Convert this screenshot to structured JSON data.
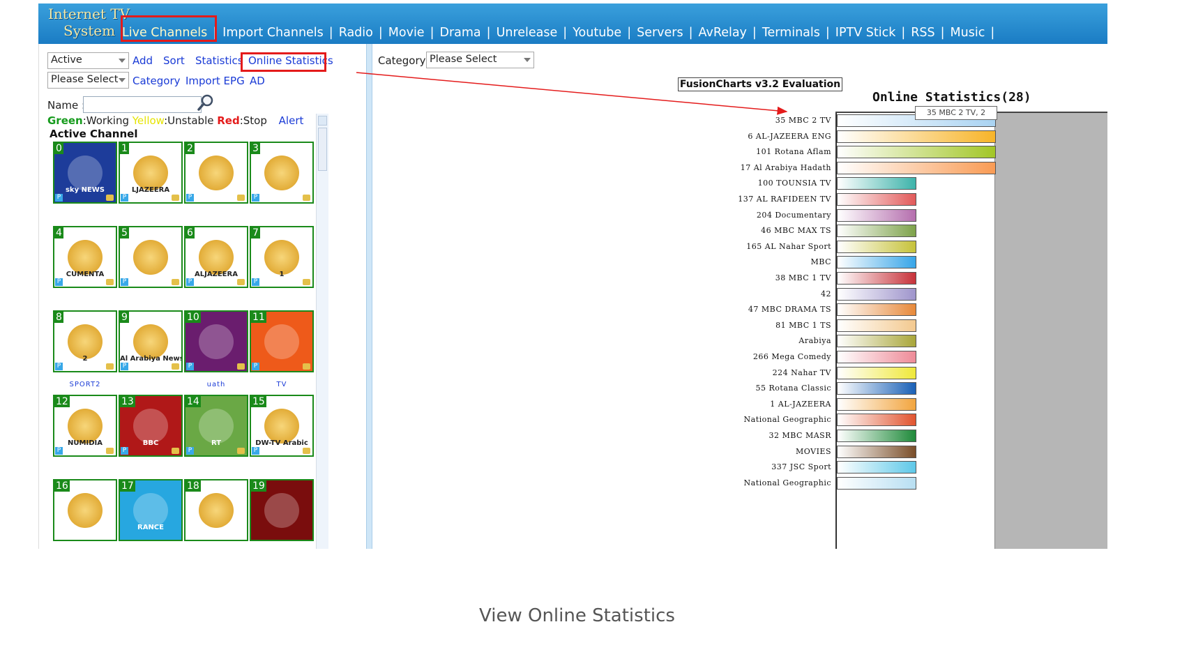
{
  "header": {
    "logo_line1": "Internet TV",
    "logo_line2": "System",
    "nav": [
      "Live Channels",
      "Import Channels",
      "Radio",
      "Movie",
      "Drama",
      "Unrelease",
      "Youtube",
      "Servers",
      "AvRelay",
      "Terminals",
      "IPTV Stick",
      "RSS",
      "Music"
    ],
    "active_nav": "Live Channels"
  },
  "left": {
    "status_select": "Active",
    "category_select": "Please Select",
    "links_row1": [
      "Add",
      "Sort",
      "Statistics",
      "Online Statistics"
    ],
    "links_row2": [
      "Category",
      "Import EPG",
      "AD"
    ],
    "name_label": "Name :",
    "legend": {
      "green": "Green",
      "green_text": ":Working ",
      "yellow": "Yellow",
      "yellow_text": ":Unstable ",
      "red": "Red",
      "red_text": ":Stop",
      "alert": "Alert"
    },
    "section_title": "Active Channel",
    "channels": [
      {
        "num": "0",
        "logo": "sky-news-arabia-logo",
        "bg": "#1d3c9a",
        "text": "sky NEWS"
      },
      {
        "num": "1",
        "logo": "aljazeera-logo",
        "bg": "#ffffff",
        "text": "LJAZEERA"
      },
      {
        "num": "2",
        "logo": "aljazeera-logo",
        "bg": "#ffffff",
        "text": ""
      },
      {
        "num": "3",
        "logo": "aljazeera-logo",
        "bg": "#ffffff",
        "text": ""
      },
      {
        "num": "4",
        "logo": "aljazeera-documentary-logo",
        "bg": "#ffffff",
        "text": "CUMENTA"
      },
      {
        "num": "5",
        "logo": "aljazeera-children-logo",
        "bg": "#ffffff",
        "text": ""
      },
      {
        "num": "6",
        "logo": "aljazeera-english-logo",
        "bg": "#ffffff",
        "text": "ALJAZEERA"
      },
      {
        "num": "7",
        "logo": "aljazeera-sport1-logo",
        "bg": "#ffffff",
        "text": "1"
      },
      {
        "num": "8",
        "logo": "aljazeera-sport2-logo",
        "bg": "#ffffff",
        "text": "2"
      },
      {
        "num": "9",
        "logo": "alarabiya-logo",
        "bg": "#ffffff",
        "text": "Al Arabiya News Channel"
      },
      {
        "num": "10",
        "logo": "alarabiya-alhadath-logo",
        "bg": "#6a1d6e",
        "text": ""
      },
      {
        "num": "11",
        "logo": "almayadeen-logo",
        "bg": "#ee5a1a",
        "text": ""
      },
      {
        "num": "12",
        "logo": "numidia-logo",
        "bg": "#ffffff",
        "text": "NUMIDIA"
      },
      {
        "num": "13",
        "logo": "bbc-arabic-logo",
        "bg": "#b01818",
        "text": "BBC"
      },
      {
        "num": "14",
        "logo": "rt-arabic-logo",
        "bg": "#6aa845",
        "text": "RT"
      },
      {
        "num": "15",
        "logo": "dw-tv-arabic-logo",
        "bg": "#ffffff",
        "text": "DW-TV Arabic"
      },
      {
        "num": "16",
        "logo": "nbc-logo",
        "bg": "#ffffff",
        "text": ""
      },
      {
        "num": "17",
        "logo": "france24-logo",
        "bg": "#27a7e0",
        "text": "RANCE"
      },
      {
        "num": "18",
        "logo": "channel-logo",
        "bg": "#ffffff",
        "text": ""
      },
      {
        "num": "19",
        "logo": "channel-logo",
        "bg": "#7a0d0d",
        "text": ""
      }
    ],
    "captions": [
      "SPORT2",
      "uath",
      "TV"
    ]
  },
  "right": {
    "category_label": "Category:",
    "category_select": "Please Select",
    "eval_label": "FusionCharts v3.2 Evaluation",
    "tooltip": "35 MBC 2 TV, 2"
  },
  "chart_data": {
    "type": "bar",
    "orientation": "horizontal",
    "title": "Online Statistics(28)",
    "categories": [
      "35 MBC 2 TV",
      "6 AL-JAZEERA ENG",
      "101 Rotana Aflam",
      "17 Al Arabiya Hadath",
      "100 TOUNSIA TV",
      "137 AL RAFIDEEN TV",
      "204 Documentary",
      "46 MBC MAX TS",
      "165 AL Nahar Sport",
      "MBC",
      "38 MBC 1 TV",
      "42",
      "47 MBC DRAMA TS",
      "81 MBC 1 TS",
      "Arabiya",
      "266 Mega Comedy",
      "224 Nahar TV",
      "55 Rotana Classic",
      "1 AL-JAZEERA",
      "National Geographic",
      "32 MBC MASR",
      "MOVIES",
      "337 JSC Sport",
      "National Geographic"
    ],
    "values": [
      2,
      2,
      2,
      2,
      1,
      1,
      1,
      1,
      1,
      1,
      1,
      1,
      1,
      1,
      1,
      1,
      1,
      1,
      1,
      1,
      1,
      1,
      1,
      1
    ],
    "colors": [
      "#a9d3f2",
      "#f7b428",
      "#a2c626",
      "#f99b54",
      "#3db3aa",
      "#e25a5a",
      "#b56fae",
      "#7da24a",
      "#c6c23a",
      "#37a5e8",
      "#c7323a",
      "#9f95cc",
      "#e7893a",
      "#f3c98f",
      "#a9a63a",
      "#ee8b98",
      "#efe83a",
      "#1b61b7",
      "#f2a53f",
      "#e1542f",
      "#1f8a3a",
      "#7a4e29",
      "#5ec8e8",
      "#b8dff2"
    ]
  },
  "bottom_caption": "View Online Statistics"
}
